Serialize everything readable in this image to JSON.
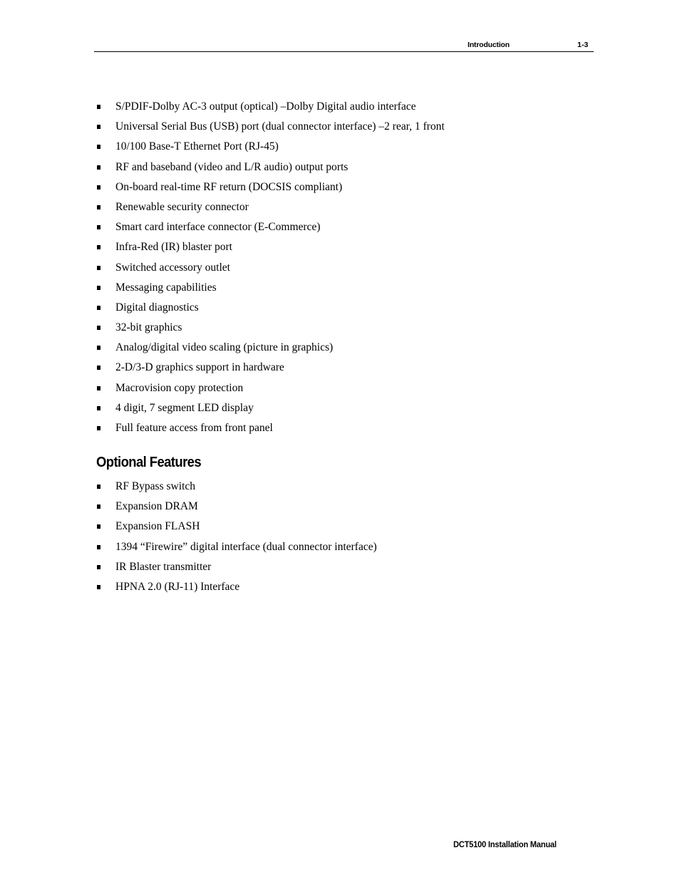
{
  "header": {
    "section": "Introduction",
    "page_number": "1-3"
  },
  "features": [
    "S/PDIF-Dolby AC-3 output (optical) –Dolby Digital audio interface",
    "Universal Serial Bus (USB) port (dual connector interface) –2 rear, 1 front",
    "10/100 Base-T Ethernet Port (RJ-45)",
    "RF and baseband (video and L/R audio) output ports",
    "On-board real-time RF return (DOCSIS compliant)",
    "Renewable security connector",
    "Smart card interface connector (E-Commerce)",
    "Infra-Red (IR) blaster port",
    "Switched accessory outlet",
    "Messaging capabilities",
    "Digital diagnostics",
    "32-bit graphics",
    "Analog/digital video scaling (picture in graphics)",
    "2-D/3-D graphics support in hardware",
    "Macrovision copy protection",
    "4 digit, 7 segment LED display",
    "Full feature access from front panel"
  ],
  "optional_features": {
    "heading": "Optional Features",
    "items": [
      "RF Bypass switch",
      "Expansion DRAM",
      "Expansion FLASH",
      "1394 “Firewire” digital interface (dual connector interface)",
      "IR Blaster transmitter",
      "HPNA 2.0 (RJ-11) Interface"
    ]
  },
  "footer": {
    "manual_title": "DCT5100 Installation Manual"
  }
}
